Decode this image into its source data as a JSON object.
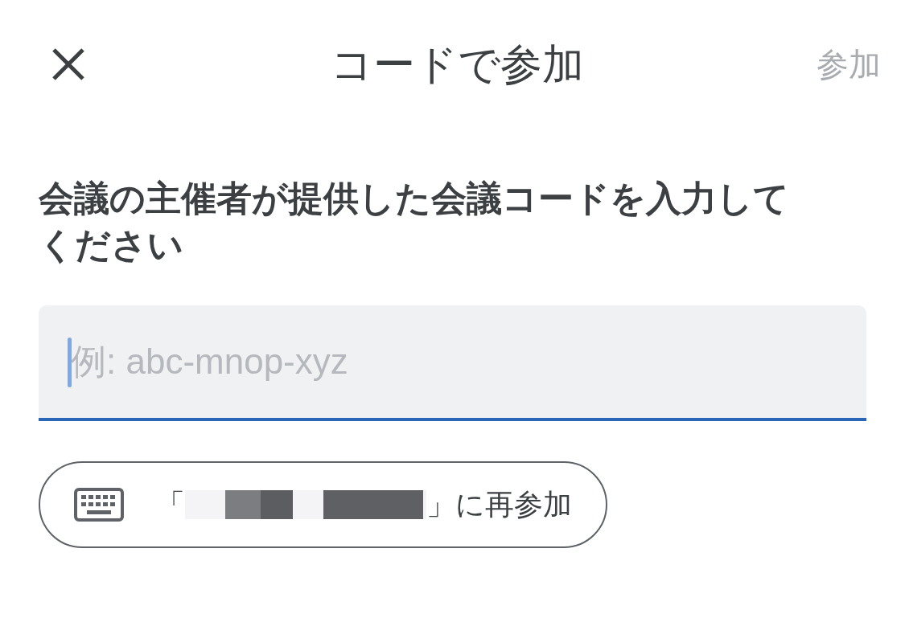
{
  "header": {
    "title": "コードで参加",
    "action": {
      "label": "参加",
      "disabled": true
    }
  },
  "instruction": "会議の主催者が提供した会議コードを入力してください",
  "code_field": {
    "placeholder": "例: abc-mnop-xyz",
    "focused": true
  },
  "rejoin_chip": {
    "prefix": "「",
    "suffix": "」に再参加"
  }
}
